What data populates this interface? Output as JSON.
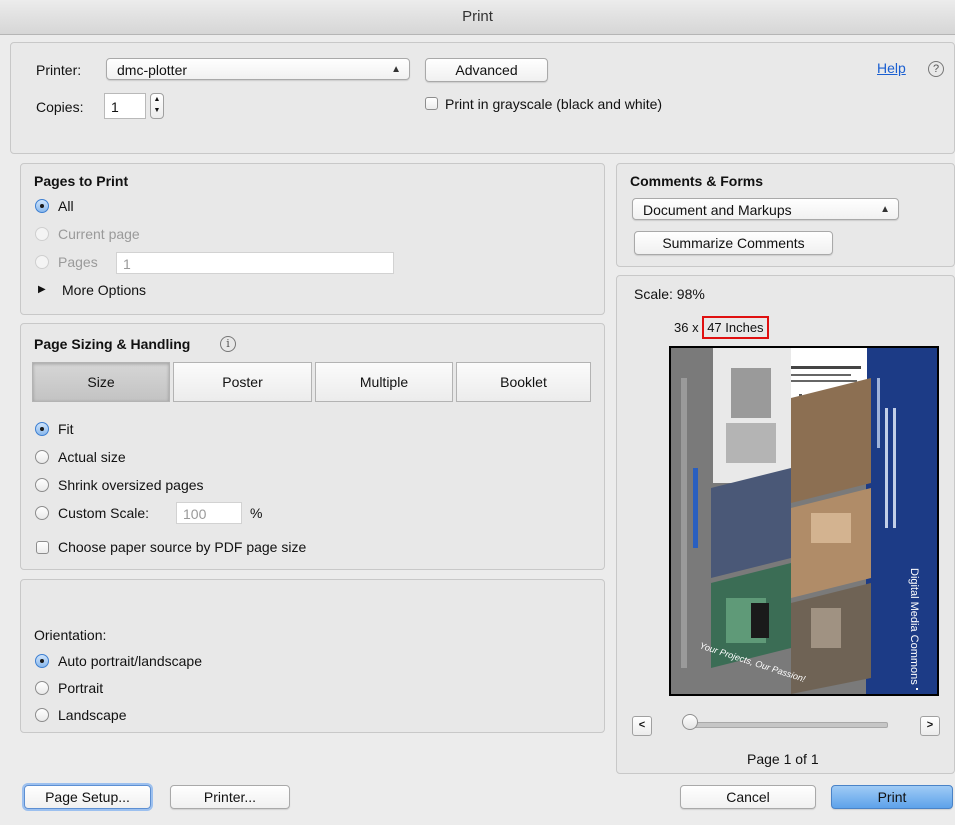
{
  "window": {
    "title": "Print"
  },
  "top": {
    "printer_label": "Printer:",
    "printer_value": "dmc-plotter",
    "advanced_label": "Advanced",
    "help_label": "Help",
    "help_icon": "?",
    "copies_label": "Copies:",
    "copies_value": "1",
    "grayscale_label": "Print in grayscale (black and white)"
  },
  "pages_to_print": {
    "title": "Pages to Print",
    "options": [
      "All",
      "Current page",
      "Pages"
    ],
    "pages_value": "1",
    "more_options": "More Options"
  },
  "sizing": {
    "title": "Page Sizing & Handling",
    "info_icon": "i",
    "tabs": [
      "Size",
      "Poster",
      "Multiple",
      "Booklet"
    ],
    "options": [
      "Fit",
      "Actual size",
      "Shrink oversized pages",
      "Custom Scale:"
    ],
    "custom_scale_value": "100",
    "percent_sign": "%",
    "paper_source_label": "Choose paper source by PDF page size"
  },
  "orientation": {
    "title": "Orientation:",
    "options": [
      "Auto portrait/landscape",
      "Portrait",
      "Landscape"
    ]
  },
  "comments": {
    "title": "Comments & Forms",
    "value": "Document and Markups",
    "summarize_label": "Summarize Comments"
  },
  "preview": {
    "scale_text": "Scale:  98%",
    "size_prefix": "36 x ",
    "size_highlight": "47 Inches",
    "prev_label": "<",
    "next_label": ">",
    "page_text": "Page 1 of 1",
    "poster_title": "Digital Media Commons",
    "poster_tagline": "Your Projects, Our Passion!"
  },
  "bottom": {
    "page_setup_label": "Page Setup...",
    "printer_label": "Printer...",
    "cancel_label": "Cancel",
    "print_label": "Print"
  },
  "colors": {
    "accent": "#5da2ea",
    "highlight_box": "#e01010",
    "link": "#1a5fd1",
    "poster_navy": "#1c3b86"
  }
}
